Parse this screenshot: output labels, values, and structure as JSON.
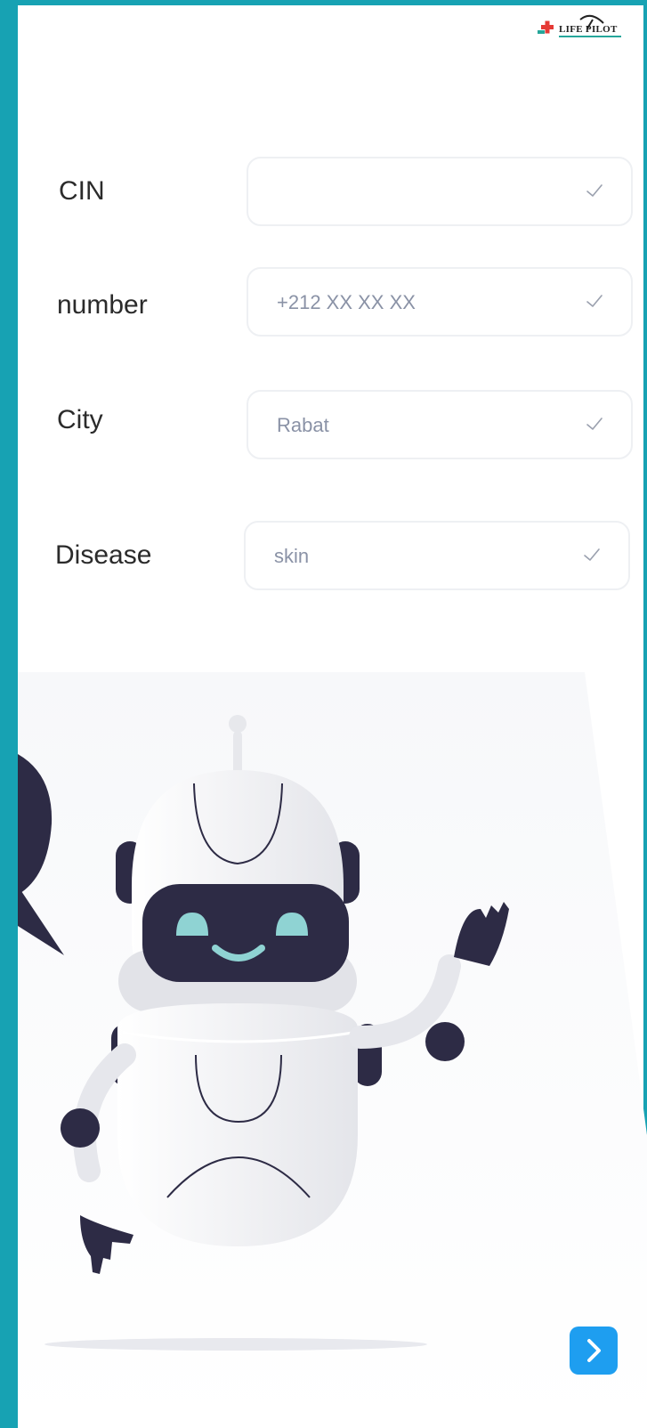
{
  "logo": {
    "text": "LIFE PILOT"
  },
  "form": {
    "fields": [
      {
        "label": "CIN",
        "value": ""
      },
      {
        "label": "number",
        "value": "+212 XX XX XX"
      },
      {
        "label": "City",
        "value": "Rabat"
      },
      {
        "label": "Disease",
        "value": "skin"
      }
    ]
  },
  "colors": {
    "frame": "#17a2b3",
    "accent": "#1e9ef0",
    "robot_dark": "#2d2b45",
    "robot_face": "#8fd3d3"
  },
  "icons": {
    "check": "check-icon",
    "next": "chevron-right-icon"
  }
}
